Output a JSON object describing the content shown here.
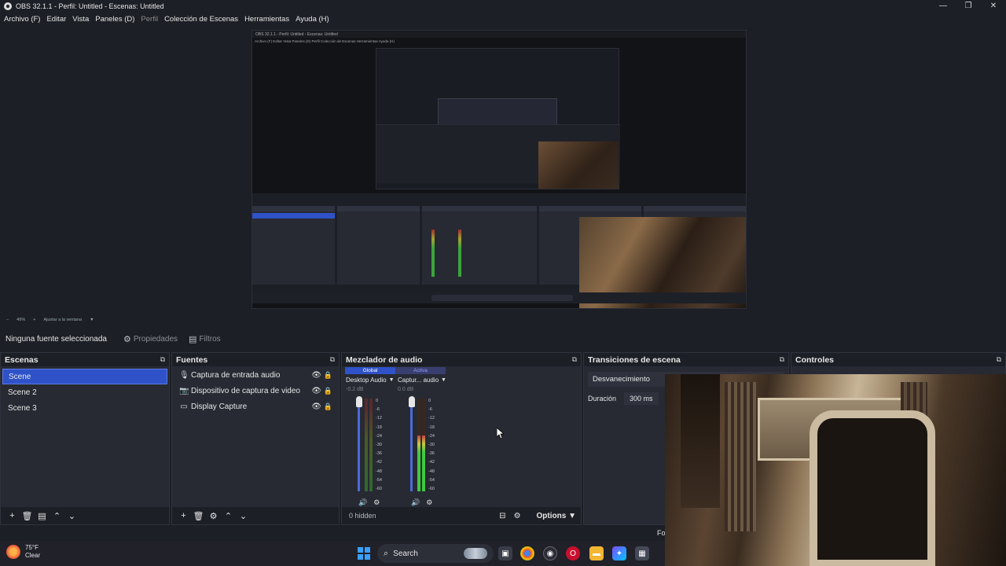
{
  "window": {
    "title": "OBS 32.1.1 - Perfil: Untitled - Escenas: Untitled",
    "controls": {
      "minimize": "—",
      "maximize": "❐",
      "close": "✕"
    }
  },
  "menu": {
    "items": [
      "Archivo (F)",
      "Editar",
      "Vista",
      "Paneles (D)",
      "Perfil",
      "Colección de Escenas",
      "Herramientas",
      "Ayuda (H)"
    ],
    "disabled_item": "Perfil"
  },
  "preview": {
    "zoom": "49%",
    "fit_label": "Ajustar a la ventana",
    "nested_title": "OBS 32.1.1 - Perfil: Untitled - Escenas: Untitled",
    "nested_menu": "Archivo (F)   Editar   Vista   Paneles (D)   Perfil   Colección de Escenas   Herramientas   Ayuda (H)"
  },
  "context_bar": {
    "no_source": "Ninguna fuente seleccionada",
    "properties": "Propiedades",
    "filters": "Filtros"
  },
  "scenes": {
    "title": "Escenas",
    "items": [
      "Scene",
      "Scene 2",
      "Scene 3"
    ],
    "selected": "Scene"
  },
  "sources": {
    "title": "Fuentes",
    "items": [
      {
        "label": "Captura de entrada audio",
        "icon": "microphone-icon"
      },
      {
        "label": "Dispositivo de captura de video",
        "icon": "camera-icon"
      },
      {
        "label": "Display Capture",
        "icon": "monitor-icon"
      }
    ]
  },
  "mixer": {
    "title": "Mezclador de audio",
    "tab_global": "Global",
    "tab_active": "Activa",
    "channels": [
      {
        "name": "Desktop Audio",
        "db": "-0.2 dB",
        "level": 0.0
      },
      {
        "name": "Captur... audio",
        "db": "0.0 dB",
        "level": 0.6
      }
    ],
    "scale": [
      "0",
      "-6",
      "-12",
      "-18",
      "-24",
      "-30",
      "-36",
      "-42",
      "-48",
      "-54",
      "-60"
    ],
    "hidden_text": "0 hidden",
    "options_label": "Options"
  },
  "transitions": {
    "title": "Transiciones de escena",
    "selected": "Desvanecimiento",
    "duration_label": "Duración",
    "duration_value": "300 ms"
  },
  "controls": {
    "title": "Controles",
    "partial_text": "Fo"
  },
  "taskbar": {
    "temperature": "75°F",
    "condition": "Clear",
    "search_label": "Search"
  },
  "colors": {
    "accent": "#2f52c8",
    "panel": "#272a33",
    "background": "#1d1f26"
  }
}
